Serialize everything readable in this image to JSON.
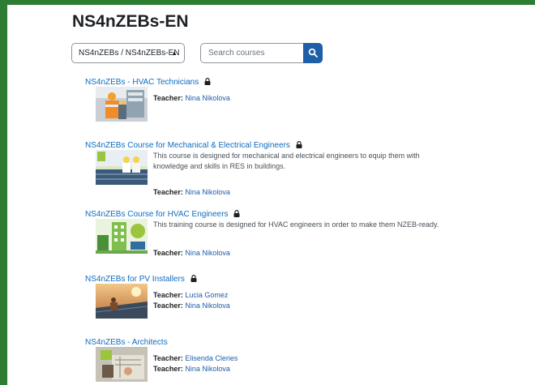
{
  "page": {
    "title": "NS4nZEBs-EN"
  },
  "filters": {
    "category_selected": "NS4nZEBs / NS4nZEBs-EN",
    "search_placeholder": "Search courses"
  },
  "teacher_label": "Teacher:",
  "courses": [
    {
      "title": "NS4nZEBs - HVAC Technicians",
      "summary": "",
      "teachers": [
        "Nina Nikolova"
      ]
    },
    {
      "title": "NS4nZEBs Course for Mechanical & Electrical Engineers",
      "summary": "This course is designed for mechanical and electrical engineers to equip them with knowledge and skills in RES in buildings.",
      "teachers": [
        "Nina Nikolova"
      ]
    },
    {
      "title": "NS4nZEBs Course for HVAC Engineers",
      "summary": "This training course is designed for HVAC engineers in order to make them NZEB-ready.",
      "teachers": [
        "Nina Nikolova"
      ]
    },
    {
      "title": "NS4nZEBs for PV Installers",
      "summary": "",
      "teachers": [
        "Lucia Gomez",
        "Nina Nikolova"
      ]
    },
    {
      "title": "NS4nZEBs - Architects",
      "summary": "",
      "teachers": [
        "Elisenda Cleries",
        "Nina Nikolova"
      ]
    }
  ],
  "icons": {
    "lock": "lock-icon",
    "search": "search-icon",
    "select_caret": "sort-caret-icon"
  },
  "colors": {
    "frame": "#2e7d32",
    "link": "#0f6cbf",
    "button": "#1f5ea8"
  }
}
